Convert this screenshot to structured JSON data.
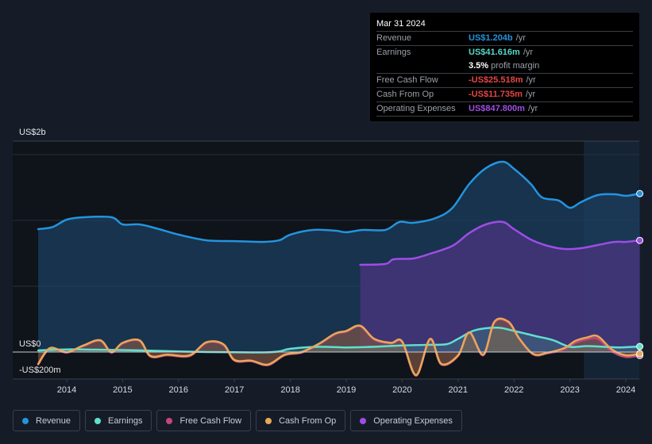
{
  "tooltip": {
    "date": "Mar 31 2024",
    "rows": [
      {
        "label": "Revenue",
        "value": "US$1.204b",
        "unit": "/yr",
        "color": "#2394df"
      },
      {
        "label": "Earnings",
        "value": "US$41.616m",
        "unit": "/yr",
        "color": "#58d6c6"
      },
      {
        "label": "",
        "margin_value": "3.5%",
        "margin_text": "profit margin"
      },
      {
        "label": "Free Cash Flow",
        "value": "-US$25.518m",
        "unit": "/yr",
        "color": "#e64646"
      },
      {
        "label": "Cash From Op",
        "value": "-US$11.735m",
        "unit": "/yr",
        "color": "#e64646"
      },
      {
        "label": "Operating Expenses",
        "value": "US$847.800m",
        "unit": "/yr",
        "color": "#a04ee8"
      }
    ]
  },
  "legend": [
    {
      "label": "Revenue",
      "color": "#2394df"
    },
    {
      "label": "Earnings",
      "color": "#5fe0cf"
    },
    {
      "label": "Free Cash Flow",
      "color": "#c4457f"
    },
    {
      "label": "Cash From Op",
      "color": "#e8a857"
    },
    {
      "label": "Operating Expenses",
      "color": "#9d4de6"
    }
  ],
  "chart_data": {
    "type": "area",
    "title": "",
    "xlabel": "",
    "ylabel": "",
    "y_unit": "US$ millions",
    "y_tick_labels": [
      {
        "label": "US$2b",
        "value": 2000
      },
      {
        "label": "US$0",
        "value": 0
      },
      {
        "label": "-US$200m",
        "value": -200
      }
    ],
    "x_tick_labels": [
      "2014",
      "2015",
      "2016",
      "2017",
      "2018",
      "2019",
      "2020",
      "2021",
      "2022",
      "2023",
      "2024"
    ],
    "x_ticks": [
      2014,
      2015,
      2016,
      2017,
      2018,
      2019,
      2020,
      2021,
      2022,
      2023,
      2024
    ],
    "xlim": [
      2013.1,
      2024.3
    ],
    "ylim": [
      -200,
      1600
    ],
    "grid": true,
    "highlight_from": 2023.25,
    "series": [
      {
        "name": "Revenue",
        "color": "#2394df",
        "x": [
          2013.49,
          2013.75,
          2014.0,
          2014.3,
          2014.8,
          2015.0,
          2015.3,
          2015.6,
          2016.0,
          2016.5,
          2017.0,
          2017.5,
          2017.8,
          2018.0,
          2018.4,
          2018.8,
          2019.0,
          2019.3,
          2019.7,
          2019.95,
          2020.2,
          2020.6,
          2020.9,
          2021.2,
          2021.5,
          2021.8,
          2022.0,
          2022.3,
          2022.5,
          2022.8,
          2023.0,
          2023.2,
          2023.5,
          2023.8,
          2024.0,
          2024.25
        ],
        "values": [
          934,
          950,
          1006,
          1024,
          1024,
          970,
          970,
          940,
          892,
          849,
          843,
          837,
          849,
          892,
          928,
          922,
          910,
          928,
          928,
          988,
          982,
          1018,
          1096,
          1277,
          1398,
          1446,
          1392,
          1277,
          1175,
          1151,
          1096,
          1139,
          1193,
          1199,
          1187,
          1204
        ]
      },
      {
        "name": "Operating Expenses",
        "color": "#9d4de6",
        "x": [
          2019.25,
          2019.7,
          2019.85,
          2020.2,
          2020.5,
          2020.9,
          2021.2,
          2021.5,
          2021.8,
          2022.0,
          2022.3,
          2022.6,
          2022.9,
          2023.2,
          2023.5,
          2023.8,
          2024.0,
          2024.25
        ],
        "values": [
          663,
          669,
          705,
          711,
          747,
          807,
          904,
          970,
          988,
          934,
          855,
          807,
          783,
          789,
          813,
          837,
          837,
          848
        ]
      },
      {
        "name": "Earnings",
        "color": "#5fe0cf",
        "x": [
          2013.49,
          2014.0,
          2014.5,
          2015.0,
          2015.5,
          2016.0,
          2016.5,
          2017.0,
          2017.5,
          2017.8,
          2018.0,
          2018.5,
          2019.0,
          2019.5,
          2020.0,
          2020.5,
          2020.8,
          2021.0,
          2021.3,
          2021.7,
          2022.0,
          2022.4,
          2022.7,
          2023.0,
          2023.3,
          2023.6,
          2023.9,
          2024.25
        ],
        "values": [
          12,
          20,
          18,
          15,
          10,
          5,
          0,
          -2,
          -3,
          5,
          25,
          40,
          35,
          40,
          50,
          55,
          60,
          100,
          165,
          185,
          160,
          120,
          90,
          40,
          45,
          40,
          35,
          42
        ]
      },
      {
        "name": "Cash From Op",
        "color": "#e8a857",
        "x": [
          2013.49,
          2013.7,
          2014.0,
          2014.3,
          2014.6,
          2014.8,
          2015.0,
          2015.3,
          2015.5,
          2015.8,
          2016.2,
          2016.5,
          2016.8,
          2017.0,
          2017.3,
          2017.6,
          2017.9,
          2018.2,
          2018.5,
          2018.8,
          2019.0,
          2019.25,
          2019.5,
          2019.8,
          2020.0,
          2020.25,
          2020.5,
          2020.7,
          2021.0,
          2021.2,
          2021.45,
          2021.65,
          2021.9,
          2022.1,
          2022.35,
          2022.6,
          2022.9,
          2023.1,
          2023.3,
          2023.5,
          2023.75,
          2024.0,
          2024.25
        ],
        "values": [
          -90,
          30,
          0,
          50,
          90,
          0,
          70,
          90,
          -30,
          -20,
          -25,
          75,
          60,
          -60,
          -65,
          -95,
          -20,
          0,
          60,
          140,
          160,
          200,
          100,
          70,
          80,
          -175,
          100,
          -90,
          -25,
          150,
          -20,
          230,
          230,
          100,
          -15,
          -5,
          30,
          85,
          110,
          120,
          20,
          -25,
          -12
        ]
      },
      {
        "name": "Free Cash Flow",
        "color": "#c4457f",
        "x": [
          2013.49,
          2013.7,
          2014.0,
          2014.3,
          2014.6,
          2014.8,
          2015.0,
          2015.3,
          2015.5,
          2015.8,
          2016.2,
          2016.5,
          2016.8,
          2017.0,
          2017.3,
          2017.6,
          2017.9,
          2018.2,
          2018.5,
          2018.8,
          2019.0,
          2019.25,
          2019.5,
          2019.8,
          2020.0,
          2020.25,
          2020.5,
          2020.7,
          2021.0,
          2021.2,
          2021.45,
          2021.65,
          2021.9,
          2022.1,
          2022.35,
          2022.6,
          2022.9,
          2023.1,
          2023.3,
          2023.5,
          2023.75,
          2024.0,
          2024.25
        ],
        "values": [
          -95,
          25,
          -5,
          45,
          85,
          -5,
          65,
          85,
          -35,
          -25,
          -30,
          70,
          55,
          -65,
          -70,
          -100,
          -25,
          -5,
          55,
          135,
          155,
          195,
          95,
          65,
          75,
          -180,
          95,
          -95,
          -30,
          145,
          -25,
          225,
          225,
          95,
          -20,
          -10,
          20,
          70,
          95,
          100,
          5,
          -38,
          -26
        ]
      }
    ]
  }
}
